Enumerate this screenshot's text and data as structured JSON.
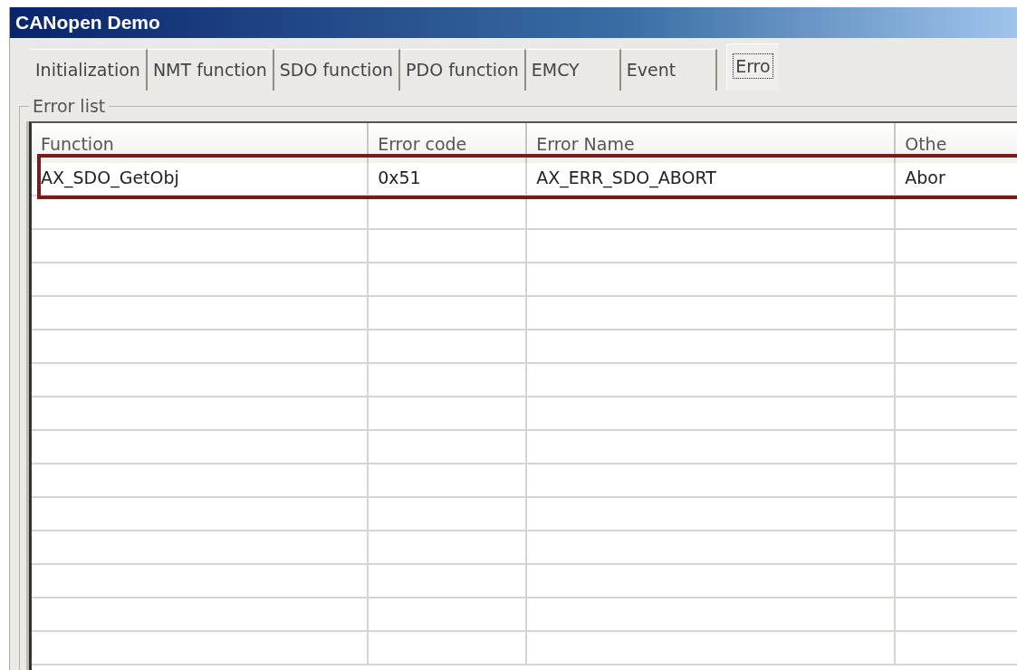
{
  "window": {
    "title": "CANopen Demo"
  },
  "tabs": [
    {
      "label": "Initialization",
      "selected": false
    },
    {
      "label": "NMT function",
      "selected": false
    },
    {
      "label": "SDO function",
      "selected": false
    },
    {
      "label": "PDO function",
      "selected": false
    },
    {
      "label": "EMCY",
      "selected": false
    },
    {
      "label": "Event",
      "selected": false
    },
    {
      "label": "Erro",
      "selected": true
    }
  ],
  "group": {
    "title": "Error list"
  },
  "table": {
    "columns": [
      "Function",
      "Error code",
      "Error Name",
      "Othe"
    ],
    "rows": [
      {
        "cells": [
          "AX_SDO_GetObj",
          "0x51",
          "AX_ERR_SDO_ABORT",
          "Abor"
        ],
        "highlighted": true
      }
    ]
  }
}
